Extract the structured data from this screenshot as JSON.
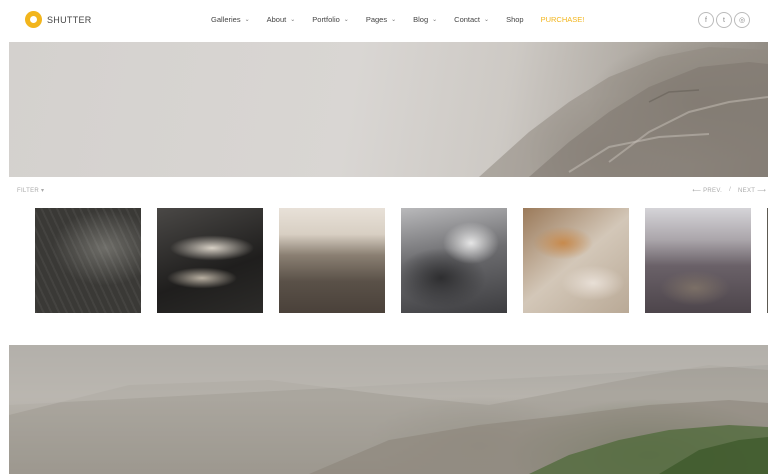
{
  "header": {
    "logo_text": "SHUTTER",
    "nav": [
      {
        "label": "Galleries",
        "has_dropdown": true
      },
      {
        "label": "About",
        "has_dropdown": true
      },
      {
        "label": "Portfolio",
        "has_dropdown": true
      },
      {
        "label": "Pages",
        "has_dropdown": true
      },
      {
        "label": "Blog",
        "has_dropdown": true
      },
      {
        "label": "Contact",
        "has_dropdown": true
      },
      {
        "label": "Shop",
        "has_dropdown": false
      },
      {
        "label": "PURCHASE!",
        "has_dropdown": false
      }
    ],
    "social": [
      {
        "icon": "facebook-icon",
        "glyph": "f"
      },
      {
        "icon": "twitter-icon",
        "glyph": "t"
      },
      {
        "icon": "instagram-icon",
        "glyph": "◎"
      }
    ],
    "accent_color": "#f2b51c"
  },
  "gallery": {
    "filter_label": "FILTER ▾",
    "prev_label": "⟵ PREV.",
    "separator": "/",
    "next_label": "NEXT ⟶",
    "thumbnails": [
      {
        "subject": "leaf-close-up"
      },
      {
        "subject": "feathers"
      },
      {
        "subject": "aerial-landscape"
      },
      {
        "subject": "storm-clouds"
      },
      {
        "subject": "crumpled-paper"
      },
      {
        "subject": "canyon"
      },
      {
        "subject": "partial-image"
      }
    ]
  }
}
